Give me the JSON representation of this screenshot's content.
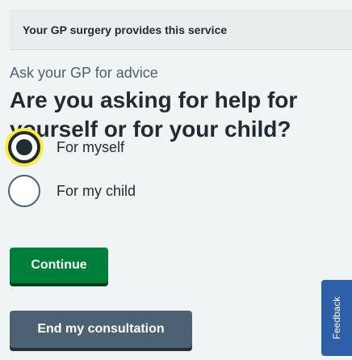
{
  "banner": {
    "text": "Your GP surgery provides this service"
  },
  "question": {
    "caption": "Ask your GP for advice",
    "heading": "Are you asking for help for yourself or for your child?"
  },
  "options": [
    {
      "label": "For myself",
      "checked": true
    },
    {
      "label": "For my child",
      "checked": false
    }
  ],
  "buttons": {
    "continue_label": "Continue",
    "end_label": "End my consultation"
  },
  "feedback": {
    "label": "Feedback"
  },
  "colors": {
    "primary_button": "#007f3b",
    "secondary_button": "#4c6272",
    "feedback_tab": "#2f5fa8",
    "focus_ring": "#ffeb3b"
  }
}
